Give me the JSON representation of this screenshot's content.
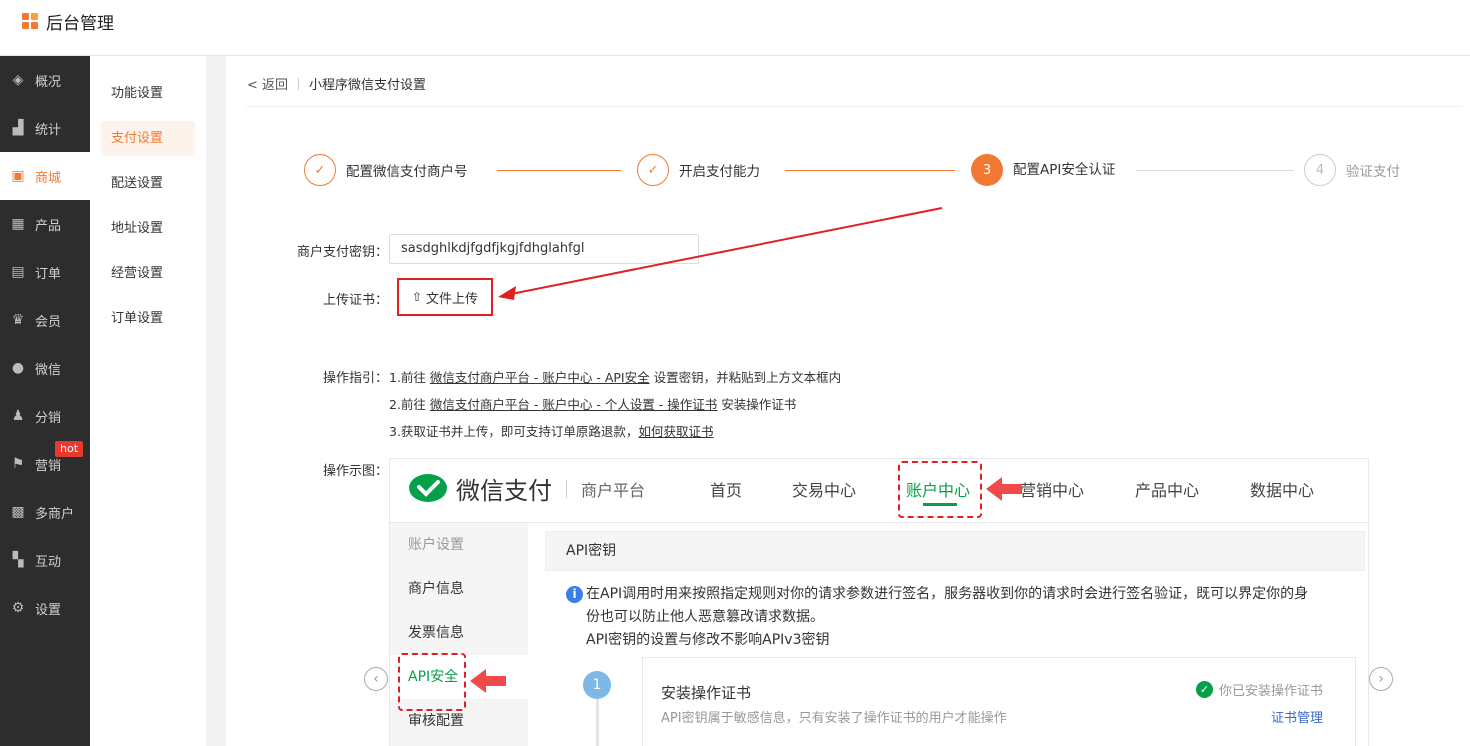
{
  "app": {
    "title": "后台管理"
  },
  "sidebar": {
    "items": [
      {
        "label": "概况",
        "icon": "layers-icon"
      },
      {
        "label": "统计",
        "icon": "chart-icon"
      },
      {
        "label": "商城",
        "icon": "shop-icon",
        "active": true
      },
      {
        "label": "产品",
        "icon": "grid-icon"
      },
      {
        "label": "订单",
        "icon": "order-icon"
      },
      {
        "label": "会员",
        "icon": "crown-icon"
      },
      {
        "label": "微信",
        "icon": "wechat-icon"
      },
      {
        "label": "分销",
        "icon": "user-share-icon"
      },
      {
        "label": "营销",
        "icon": "flag-icon",
        "badge": "hot"
      },
      {
        "label": "多商户",
        "icon": "multi-store-icon"
      },
      {
        "label": "互动",
        "icon": "interact-icon"
      },
      {
        "label": "设置",
        "icon": "gear-icon"
      }
    ]
  },
  "subnav": {
    "items": [
      "功能设置",
      "支付设置",
      "配送设置",
      "地址设置",
      "经营设置",
      "订单设置"
    ],
    "active": "支付设置"
  },
  "breadcrumb": {
    "back": "< 返回",
    "title": "小程序微信支付设置"
  },
  "steps": [
    {
      "num": "1",
      "label": "配置微信支付商户号",
      "state": "done"
    },
    {
      "num": "2",
      "label": "开启支付能力",
      "state": "done"
    },
    {
      "num": "3",
      "label": "配置API安全认证",
      "state": "active"
    },
    {
      "num": "4",
      "label": "验证支付",
      "state": "todo"
    }
  ],
  "form": {
    "secret_label": "商户支付密钥：",
    "secret_value": "sasdghlkdjfgdfjkgjfdhglahfgl",
    "cert_label": "上传证书：",
    "upload_button": "文件上传"
  },
  "guide": {
    "label": "操作指引：",
    "line1_pre": "1.前往 ",
    "line1_link": "微信支付商户平台 - 账户中心 - API安全",
    "line1_post": " 设置密钥，并粘贴到上方文本框内",
    "line2_pre": "2.前往 ",
    "line2_link": "微信支付商户平台 - 账户中心 - 个人设置 - 操作证书",
    "line2_post": " 安装操作证书",
    "line3_pre": "3.获取证书并上传，即可支持订单原路退款，",
    "line3_link": "如何获取证书"
  },
  "demo": {
    "label": "操作示图：",
    "brand": "微信支付",
    "platform": "商户平台",
    "nav": [
      "首页",
      "交易中心",
      "账户中心",
      "营销中心",
      "产品中心",
      "数据中心"
    ],
    "side": [
      "账户设置",
      "商户信息",
      "发票信息",
      "API安全",
      "审核配置"
    ],
    "card_title": "API密钥",
    "info_line1": "在API调用时用来按照指定规则对你的请求参数进行签名，服务器收到你的请求时会进行签名验证，既可以界定你的身",
    "info_line2": "份也可以防止他人恶意篡改请求数据。",
    "info_line3": "API密钥的设置与修改不影响APIv3密钥",
    "step_num": "1",
    "step_title": "安装操作证书",
    "step_desc": "API密钥属于敏感信息，只有安装了操作证书的用户才能操作",
    "step_status": "你已安装操作证书",
    "step_link": "证书管理"
  },
  "colors": {
    "accent": "#f27934",
    "wechat_green": "#07a04a",
    "annotation_red": "#e02020",
    "sidebar_bg": "#2d2d2d"
  }
}
